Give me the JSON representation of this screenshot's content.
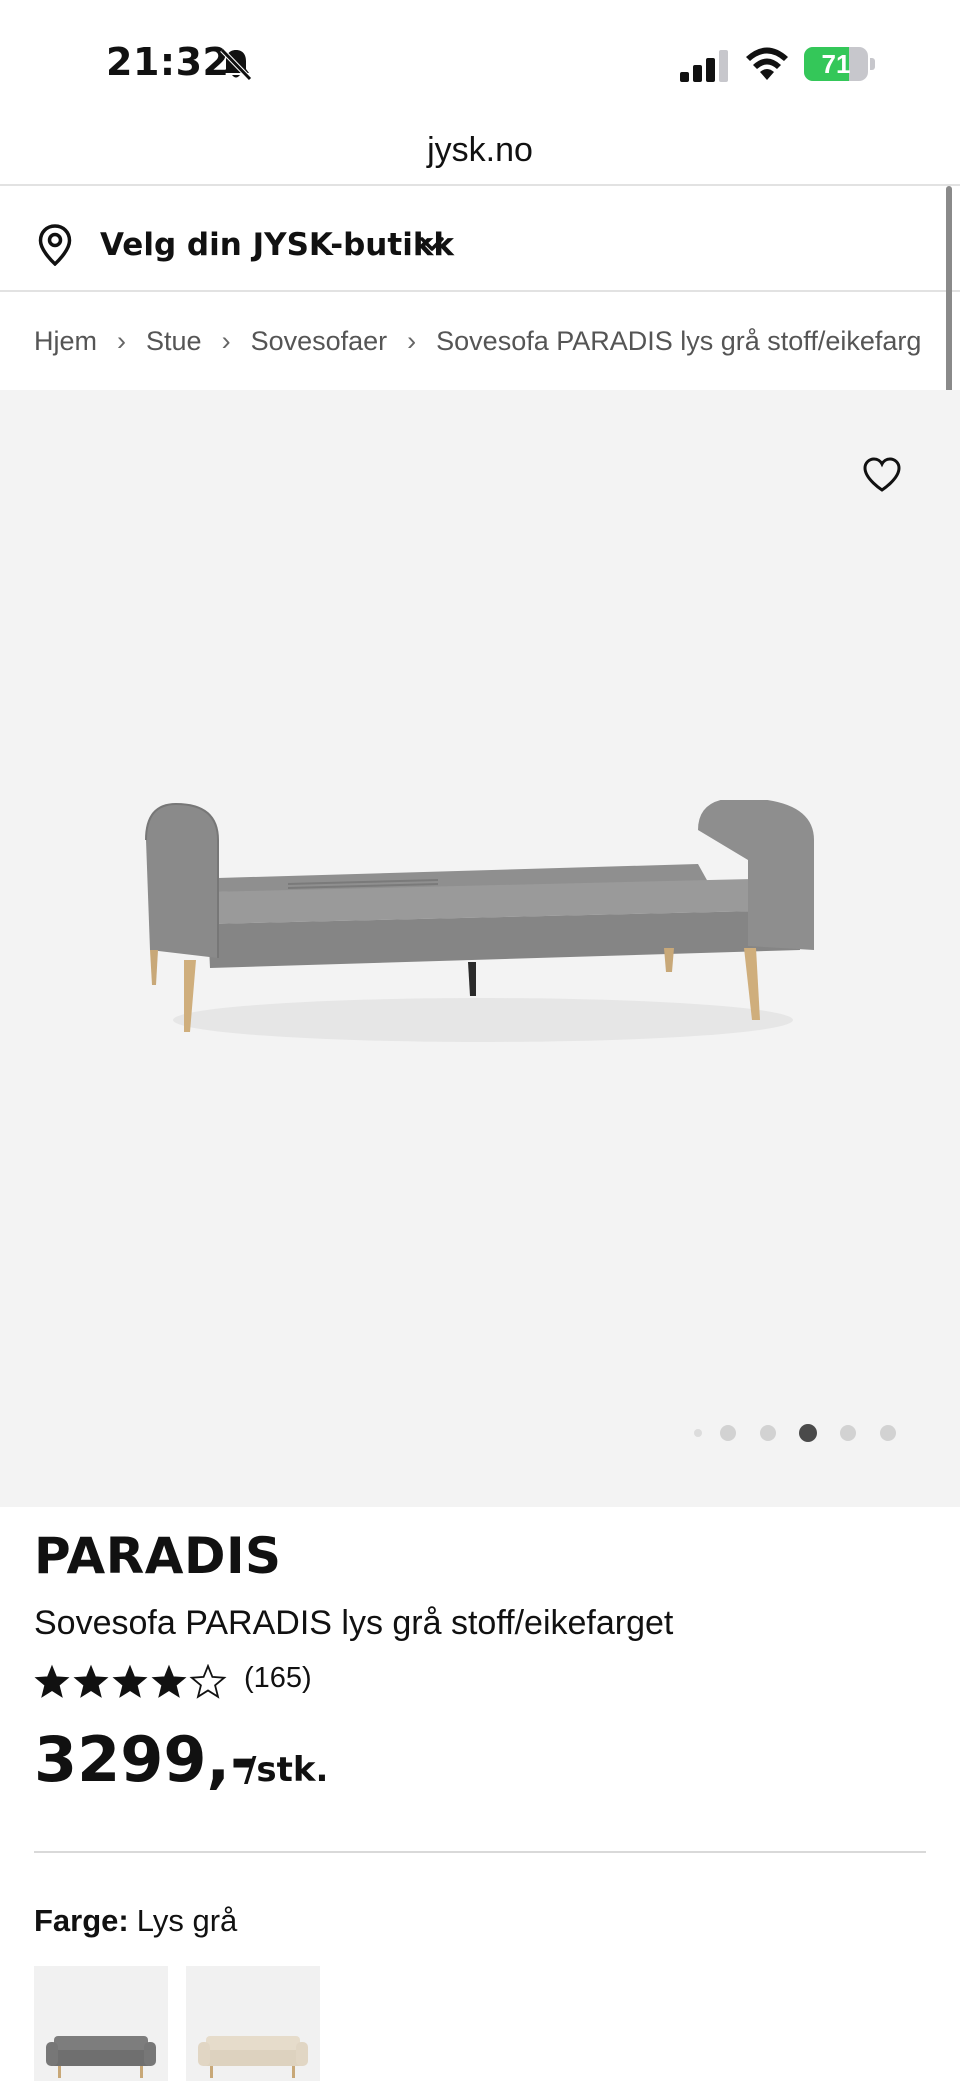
{
  "status_bar": {
    "time": "21:32",
    "battery_percent": 71,
    "battery_label": "71"
  },
  "browser": {
    "url": "jysk.no"
  },
  "store_selector": {
    "label": "Velg din JYSK-butikk"
  },
  "breadcrumb": [
    "Hjem",
    "Stue",
    "Sovesofaer",
    "Sovesofa PARADIS lys grå stoff/eikefarg"
  ],
  "gallery": {
    "dot_count": 6,
    "active_dot": 3
  },
  "product": {
    "name": "PARADIS",
    "description": "Sovesofa PARADIS lys grå stoff/eikefarget",
    "rating": 4,
    "rating_max": 5,
    "review_count": "(165)",
    "price": "3299,-",
    "unit": "/stk."
  },
  "color": {
    "label": "Farge:",
    "selected": "Lys grå",
    "options": [
      {
        "name": "light-grey",
        "body": "#7d7d7d",
        "legs": "#c8a878"
      },
      {
        "name": "beige",
        "body": "#e6dccb",
        "legs": "#c8a878"
      }
    ]
  },
  "colors": {
    "battery_green": "#34c759",
    "gallery_bg": "#f3f3f3",
    "sofa_grey": "#8c8c8c"
  }
}
